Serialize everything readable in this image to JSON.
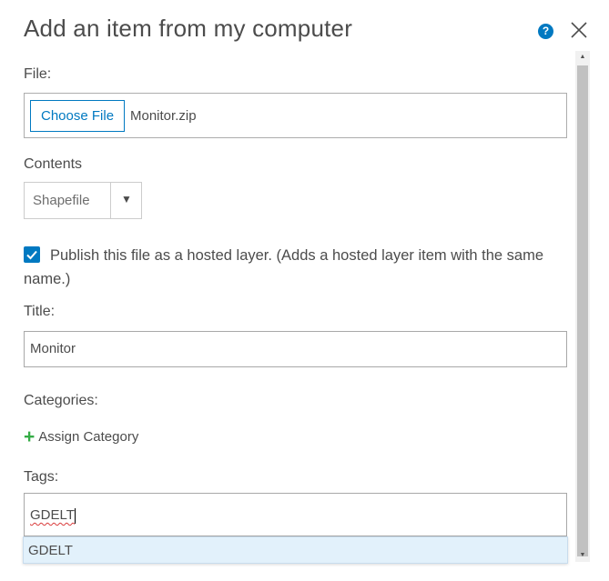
{
  "dialog": {
    "title": "Add an item from my computer",
    "help_icon": "question-icon",
    "help_glyph": "?",
    "close_icon": "close-icon"
  },
  "file": {
    "label": "File:",
    "button_label": "Choose File",
    "file_name": "Monitor.zip"
  },
  "contents": {
    "label": "Contents",
    "selected": "Shapefile",
    "arrow": "▼"
  },
  "publish": {
    "checked": true,
    "label": "Publish this file as a hosted layer. (Adds a hosted layer item with the same name.)"
  },
  "title_field": {
    "label": "Title:",
    "value": "Monitor"
  },
  "categories": {
    "label": "Categories:",
    "assign_label": "Assign Category",
    "plus": "+"
  },
  "tags": {
    "label": "Tags:",
    "value": "GDELT",
    "suggestions": [
      "GDELT"
    ]
  },
  "scrollbar": {
    "up": "▲",
    "down": "▼"
  },
  "colors": {
    "accent": "#0079c1",
    "text": "#4c4c4c",
    "plus_green": "#35ac46",
    "suggestion_bg": "#e2f1fb"
  }
}
